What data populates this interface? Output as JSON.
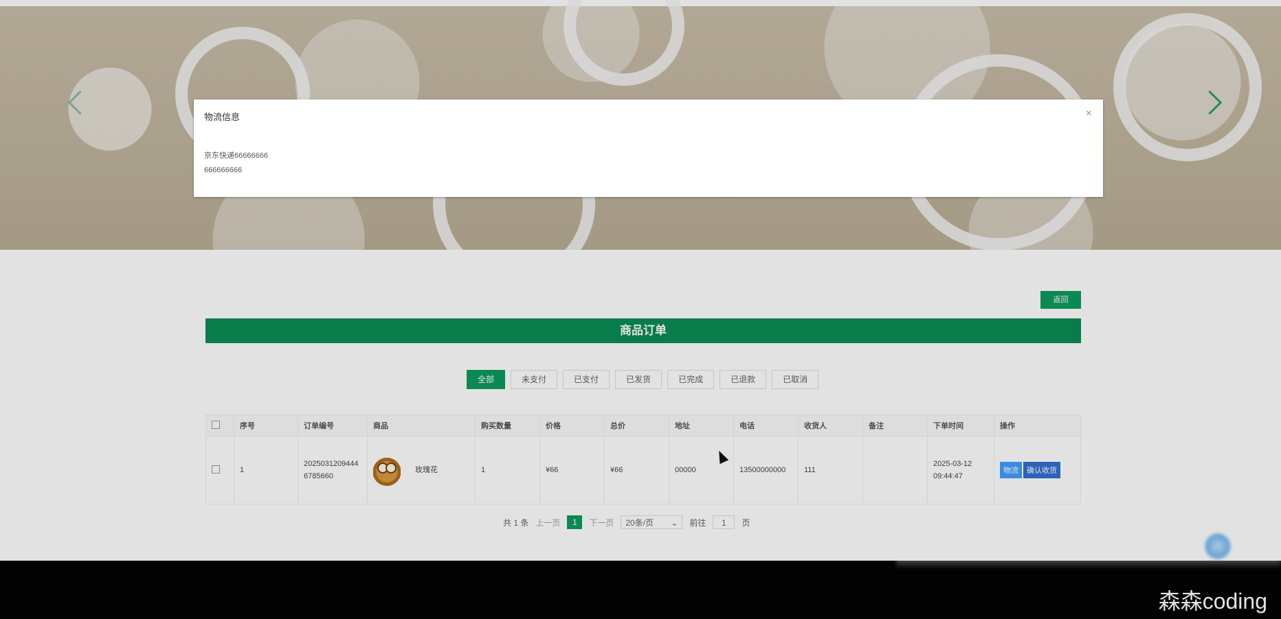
{
  "dialog": {
    "title": "物流信息",
    "close_icon": "×",
    "line1": "京东快递66666666",
    "line2": "666666666"
  },
  "header": {
    "back_label": "返回",
    "title": "商品订单"
  },
  "tabs": [
    {
      "label": "全部",
      "active": true
    },
    {
      "label": "未支付"
    },
    {
      "label": "已支付"
    },
    {
      "label": "已发货"
    },
    {
      "label": "已完成"
    },
    {
      "label": "已退款"
    },
    {
      "label": "已取消"
    }
  ],
  "table": {
    "columns": [
      "序号",
      "订单编号",
      "商品",
      "购买数量",
      "价格",
      "总价",
      "地址",
      "电话",
      "收货人",
      "备注",
      "下单时间",
      "操作"
    ],
    "rows": [
      {
        "index": "1",
        "order_no": "20250312094446785660",
        "product_name": "玫瑰花",
        "quantity": "1",
        "price": "¥66",
        "total": "¥66",
        "address": "00000",
        "phone": "13500000000",
        "receiver": "111",
        "remark": "",
        "order_time": "2025-03-12 09:44:47",
        "actions": {
          "logistics": "物流",
          "confirm": "确认收货"
        }
      }
    ]
  },
  "pagination": {
    "total_text": "共 1 条",
    "prev": "上一页",
    "current": "1",
    "next": "下一页",
    "page_size": "20条/页",
    "goto_label": "前往",
    "goto_value": "1",
    "page_unit": "页"
  },
  "watermark": "森森coding",
  "colors": {
    "accent": "#0b9a5d",
    "title_bar": "#078b53",
    "logistics_btn": "#409eff",
    "confirm_btn": "#2f6fd1"
  }
}
